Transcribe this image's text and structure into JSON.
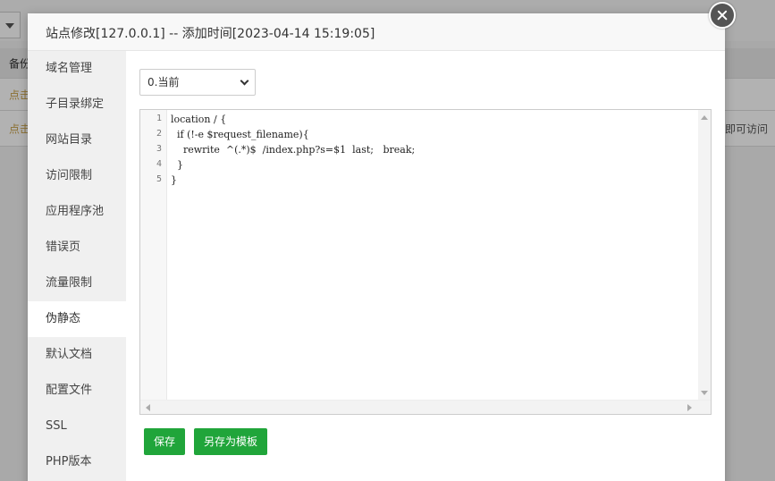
{
  "background": {
    "header_text": "备份",
    "row1_text": "点击",
    "row2_text": "点击",
    "row2_right_text": "即可访问"
  },
  "modal": {
    "title": "站点修改[127.0.0.1] -- 添加时间[2023-04-14 15:19:05]",
    "sidebar": [
      {
        "label": "域名管理"
      },
      {
        "label": "子目录绑定"
      },
      {
        "label": "网站目录"
      },
      {
        "label": "访问限制"
      },
      {
        "label": "应用程序池"
      },
      {
        "label": "错误页"
      },
      {
        "label": "流量限制"
      },
      {
        "label": "伪静态"
      },
      {
        "label": "默认文档"
      },
      {
        "label": "配置文件"
      },
      {
        "label": "SSL"
      },
      {
        "label": "PHP版本"
      }
    ],
    "active_item": "伪静态",
    "template_select": {
      "value": "0.当前"
    },
    "editor": {
      "lines": [
        "location / {",
        "  if (!-e $request_filename){",
        "    rewrite  ^(.*)$  /index.php?s=$1  last;   break;",
        "  }",
        "}"
      ],
      "line_numbers": [
        "1",
        "2",
        "3",
        "4",
        "5"
      ]
    },
    "buttons": {
      "save": "保存",
      "save_as_template": "另存为模板"
    },
    "colors": {
      "primary": "#20a53a",
      "close": "#555555"
    }
  }
}
